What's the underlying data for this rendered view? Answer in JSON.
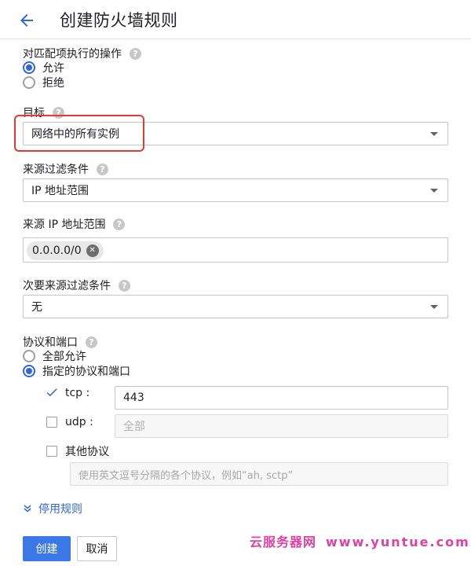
{
  "header": {
    "title": "创建防火墙规则"
  },
  "action_on_match": {
    "label": "对匹配项执行的操作",
    "options": [
      "允许",
      "拒绝"
    ],
    "selected": "允许"
  },
  "target": {
    "label": "目标",
    "value": "网络中的所有实例"
  },
  "source_filter": {
    "label": "来源过滤条件",
    "value": "IP 地址范围"
  },
  "source_ip_ranges": {
    "label": "来源 IP 地址范围",
    "chips": [
      "0.0.0.0/0"
    ]
  },
  "secondary_source_filter": {
    "label": "次要来源过滤条件",
    "value": "无"
  },
  "protocols_ports": {
    "label": "协议和端口",
    "options": [
      "全部允许",
      "指定的协议和端口"
    ],
    "selected": "指定的协议和端口",
    "tcp": {
      "label": "tcp :",
      "checked": true,
      "value": "443"
    },
    "udp": {
      "label": "udp :",
      "checked": false,
      "placeholder": "全部"
    },
    "other": {
      "label": "其他协议",
      "checked": false,
      "placeholder": "使用英文逗号分隔的各个协议，例如“ah, sctp”"
    }
  },
  "disable_rule": {
    "label": "停用规则"
  },
  "buttons": {
    "create": "创建",
    "cancel": "取消"
  },
  "watermark": {
    "text": "云服务器网",
    "url": "www.yuntue.com"
  },
  "colors": {
    "accent": "#3367d6",
    "primary_button": "#3b78e7",
    "highlight": "#e53935",
    "watermark": "#e040a0"
  }
}
